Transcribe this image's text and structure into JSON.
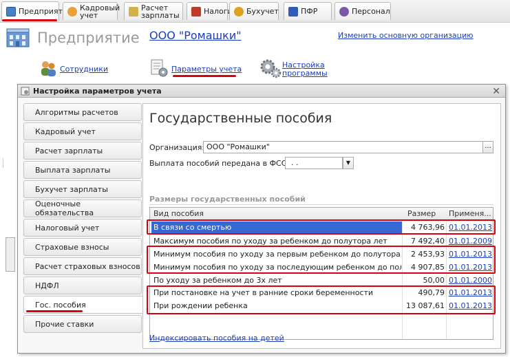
{
  "tabs": [
    {
      "label": "Предприятие",
      "icon": "enterprise-icon",
      "color": "#4a7fc6"
    },
    {
      "label": "Кадровый\nучет",
      "icon": "personnel-icon",
      "color": "#e9a13b"
    },
    {
      "label": "Расчет\nзарплаты",
      "icon": "payroll-icon",
      "color": "#d2b04a"
    },
    {
      "label": "Налоги",
      "icon": "taxes-icon",
      "color": "#c0392b"
    },
    {
      "label": "Бухучет",
      "icon": "accounting-icon",
      "color": "#e0a020"
    },
    {
      "label": "ПФР",
      "icon": "pfr-icon",
      "color": "#2f5db8"
    },
    {
      "label": "Персонал",
      "icon": "staff-icon",
      "color": "#7a5aa8"
    }
  ],
  "header": {
    "title": "Предприятие",
    "organization": "ООО \"Ромашки\"",
    "change_org": "Изменить основную организацию"
  },
  "quick_links": {
    "employees": "Сотрудники",
    "accounting_params": "Параметры учета",
    "program_settings": "Настройка\nпрограммы"
  },
  "dialog": {
    "title": "Настройка параметров учета",
    "nav": [
      "Алгоритмы расчетов",
      "Кадровый учет",
      "Расчет зарплаты",
      "Выплата зарплаты",
      "Бухучет зарплаты",
      "Оценочные обязательства",
      "Налоговый учет",
      "Страховые взносы",
      "Расчет страховых взносов",
      "НДФЛ",
      "Гос. пособия",
      "Прочие ставки"
    ],
    "active_nav": "Гос. пособия",
    "content": {
      "title": "Государственные пособия",
      "org_label": "Организация:",
      "org_value": "ООО \"Ромашки\"",
      "dots": "...",
      "fss_label": "Выплата пособий передана в ФСС с:",
      "fss_value": " .  .",
      "section": "Размеры государственных пособий",
      "columns": {
        "kind": "Вид пособия",
        "size": "Размер",
        "applied": "Применя..."
      },
      "rows": [
        {
          "kind": "В связи со смертью",
          "size": "4 763,96",
          "date": "01.01.2013"
        },
        {
          "kind": "Максимум пособия по уходу за ребенком до полутора лет",
          "size": "7 492,40",
          "date": "01.01.2009"
        },
        {
          "kind": "Минимум пособия по уходу за первым ребенком до полутора лет",
          "size": "2 453,93",
          "date": "01.01.2013"
        },
        {
          "kind": "Минимум пособия по уходу за последующим ребенком до полутора ...",
          "size": "4 907,85",
          "date": "01.01.2013"
        },
        {
          "kind": "По уходу за ребенком до 3х лет",
          "size": "50,00",
          "date": "01.01.2000"
        },
        {
          "kind": "При постановке на учет в ранние сроки беременности",
          "size": "490,79",
          "date": "01.01.2013"
        },
        {
          "kind": "При рождении ребенка",
          "size": "13 087,61",
          "date": "01.01.2013"
        }
      ],
      "index_link": "Индексировать пособия на детей"
    }
  },
  "colors": {
    "link": "#1a3cc0",
    "highlight": "#d9000d",
    "selection": "#3568d4"
  }
}
